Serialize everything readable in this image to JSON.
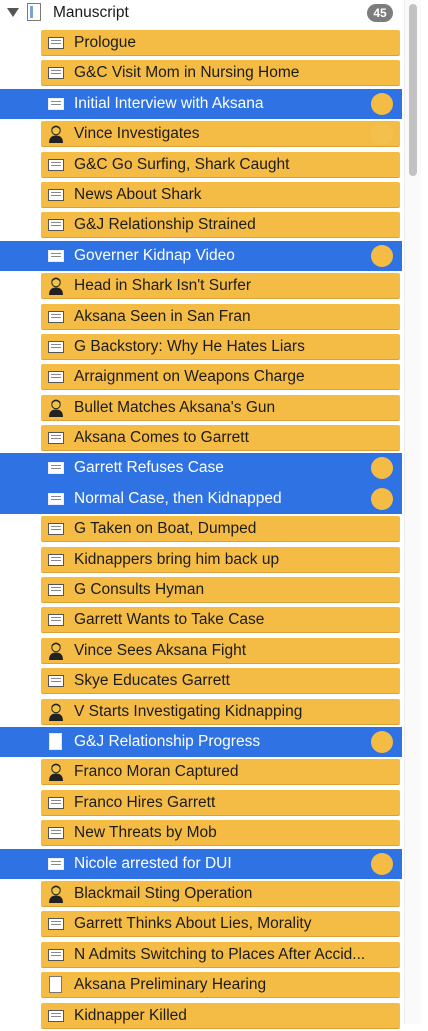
{
  "binder": {
    "title": "Manuscript",
    "count": "45",
    "items": [
      {
        "label": "Prologue",
        "icon": "text-icon",
        "selected": false,
        "status": false
      },
      {
        "label": "G&C Visit Mom in Nursing Home",
        "icon": "text-icon",
        "selected": false,
        "status": false
      },
      {
        "label": "Initial Interview with Aksana",
        "icon": "text-icon",
        "selected": true,
        "status": true
      },
      {
        "label": "Vince Investigates",
        "icon": "character-icon",
        "selected": false,
        "status": "faded"
      },
      {
        "label": "G&C Go Surfing, Shark Caught",
        "icon": "text-icon",
        "selected": false,
        "status": false
      },
      {
        "label": "News About Shark",
        "icon": "text-icon",
        "selected": false,
        "status": false
      },
      {
        "label": "G&J Relationship Strained",
        "icon": "text-icon",
        "selected": false,
        "status": false
      },
      {
        "label": "Governer Kidnap Video",
        "icon": "text-icon",
        "selected": true,
        "status": true
      },
      {
        "label": "Head in Shark Isn't Surfer",
        "icon": "character-icon",
        "selected": false,
        "status": false
      },
      {
        "label": "Aksana Seen in San Fran",
        "icon": "text-icon",
        "selected": false,
        "status": false
      },
      {
        "label": "G Backstory: Why He Hates Liars",
        "icon": "text-icon",
        "selected": false,
        "status": false
      },
      {
        "label": "Arraignment on Weapons Charge",
        "icon": "text-icon",
        "selected": false,
        "status": false
      },
      {
        "label": "Bullet Matches Aksana's Gun",
        "icon": "character-icon",
        "selected": false,
        "status": false
      },
      {
        "label": "Aksana Comes to Garrett",
        "icon": "text-icon",
        "selected": false,
        "status": false
      },
      {
        "label": "Garrett Refuses Case",
        "icon": "text-icon",
        "selected": true,
        "status": true
      },
      {
        "label": "Normal Case, then Kidnapped",
        "icon": "text-icon",
        "selected": true,
        "status": true
      },
      {
        "label": "G Taken on Boat, Dumped",
        "icon": "text-icon",
        "selected": false,
        "status": false
      },
      {
        "label": "Kidnappers bring him back up",
        "icon": "text-icon",
        "selected": false,
        "status": false
      },
      {
        "label": "G Consults Hyman",
        "icon": "text-icon",
        "selected": false,
        "status": false
      },
      {
        "label": "Garrett Wants to Take Case",
        "icon": "text-icon",
        "selected": false,
        "status": false
      },
      {
        "label": "Vince Sees Aksana Fight",
        "icon": "character-icon",
        "selected": false,
        "status": false
      },
      {
        "label": "Skye Educates Garrett",
        "icon": "text-icon",
        "selected": false,
        "status": false
      },
      {
        "label": "V Starts Investigating Kidnapping",
        "icon": "character-icon",
        "selected": false,
        "status": false
      },
      {
        "label": "G&J Relationship Progress",
        "icon": "blank-icon",
        "selected": true,
        "status": true
      },
      {
        "label": "Franco Moran Captured",
        "icon": "character-icon",
        "selected": false,
        "status": false
      },
      {
        "label": "Franco Hires Garrett",
        "icon": "text-icon",
        "selected": false,
        "status": false
      },
      {
        "label": "New Threats by Mob",
        "icon": "text-icon",
        "selected": false,
        "status": false
      },
      {
        "label": "Nicole arrested for DUI",
        "icon": "text-icon",
        "selected": true,
        "status": true
      },
      {
        "label": "Blackmail Sting Operation",
        "icon": "character-icon",
        "selected": false,
        "status": false
      },
      {
        "label": "Garrett Thinks About Lies, Morality",
        "icon": "text-icon",
        "selected": false,
        "status": false
      },
      {
        "label": "N Admits Switching to Places After Accid...",
        "icon": "text-icon",
        "selected": false,
        "status": false
      },
      {
        "label": "Aksana Preliminary Hearing",
        "icon": "blank-icon",
        "selected": false,
        "status": false
      },
      {
        "label": "Kidnapper Killed",
        "icon": "text-icon",
        "selected": false,
        "status": false
      }
    ]
  },
  "colors": {
    "card": "#f5bc45",
    "selection": "#2f72e4",
    "badge": "#7d7d7d"
  }
}
